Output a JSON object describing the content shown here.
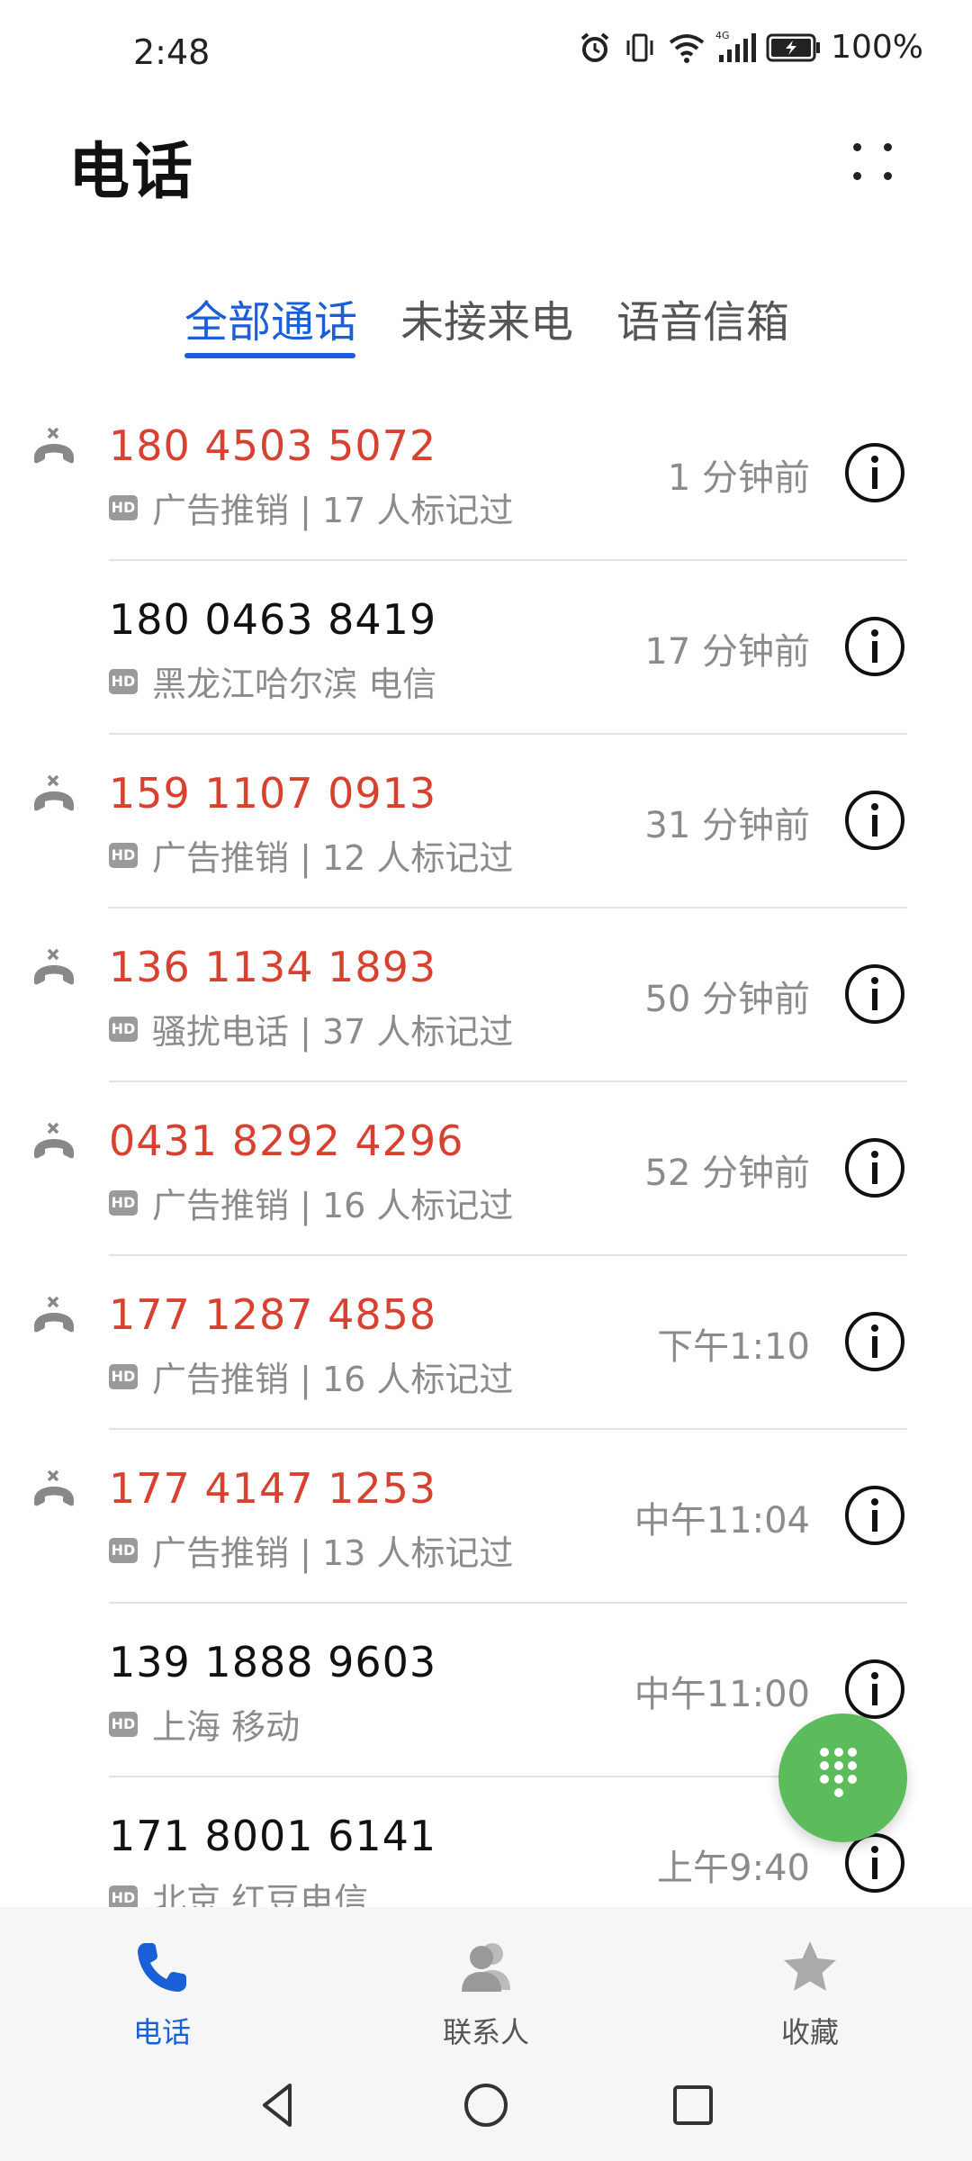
{
  "status_bar": {
    "time": "2:48",
    "battery_percent": "100%"
  },
  "header": {
    "title": "电话"
  },
  "tabs": [
    {
      "label": "全部通话",
      "active": true
    },
    {
      "label": "未接来电",
      "active": false
    },
    {
      "label": "语音信箱",
      "active": false
    }
  ],
  "badge_text": "HD",
  "calls": [
    {
      "number": "180 4503 5072",
      "detail": "广告推销 | 17 人标记过",
      "time": "1 分钟前",
      "missed": true
    },
    {
      "number": "180 0463 8419",
      "detail": "黑龙江哈尔滨 电信",
      "time": "17 分钟前",
      "missed": false
    },
    {
      "number": "159 1107 0913",
      "detail": "广告推销 | 12 人标记过",
      "time": "31 分钟前",
      "missed": true
    },
    {
      "number": "136 1134 1893",
      "detail": "骚扰电话 | 37 人标记过",
      "time": "50 分钟前",
      "missed": true
    },
    {
      "number": "0431 8292 4296",
      "detail": "广告推销 | 16 人标记过",
      "time": "52 分钟前",
      "missed": true
    },
    {
      "number": "177 1287 4858",
      "detail": "广告推销 | 16 人标记过",
      "time": "下午1:10",
      "missed": true
    },
    {
      "number": "177 4147 1253",
      "detail": "广告推销 | 13 人标记过",
      "time": "中午11:04",
      "missed": true
    },
    {
      "number": "139 1888 9603",
      "detail": "上海 移动",
      "time": "中午11:00",
      "missed": false
    },
    {
      "number": "171 8001 6141",
      "detail": "北京 红豆电信",
      "time": "上午9:40",
      "missed": false
    }
  ],
  "bottom_nav": [
    {
      "label": "电话",
      "icon": "phone-icon",
      "active": true
    },
    {
      "label": "联系人",
      "icon": "contacts-icon",
      "active": false
    },
    {
      "label": "收藏",
      "icon": "star-icon",
      "active": false
    }
  ],
  "colors": {
    "accent": "#1a5fd8",
    "missed": "#d8402f",
    "fab": "#5cbc5b"
  }
}
